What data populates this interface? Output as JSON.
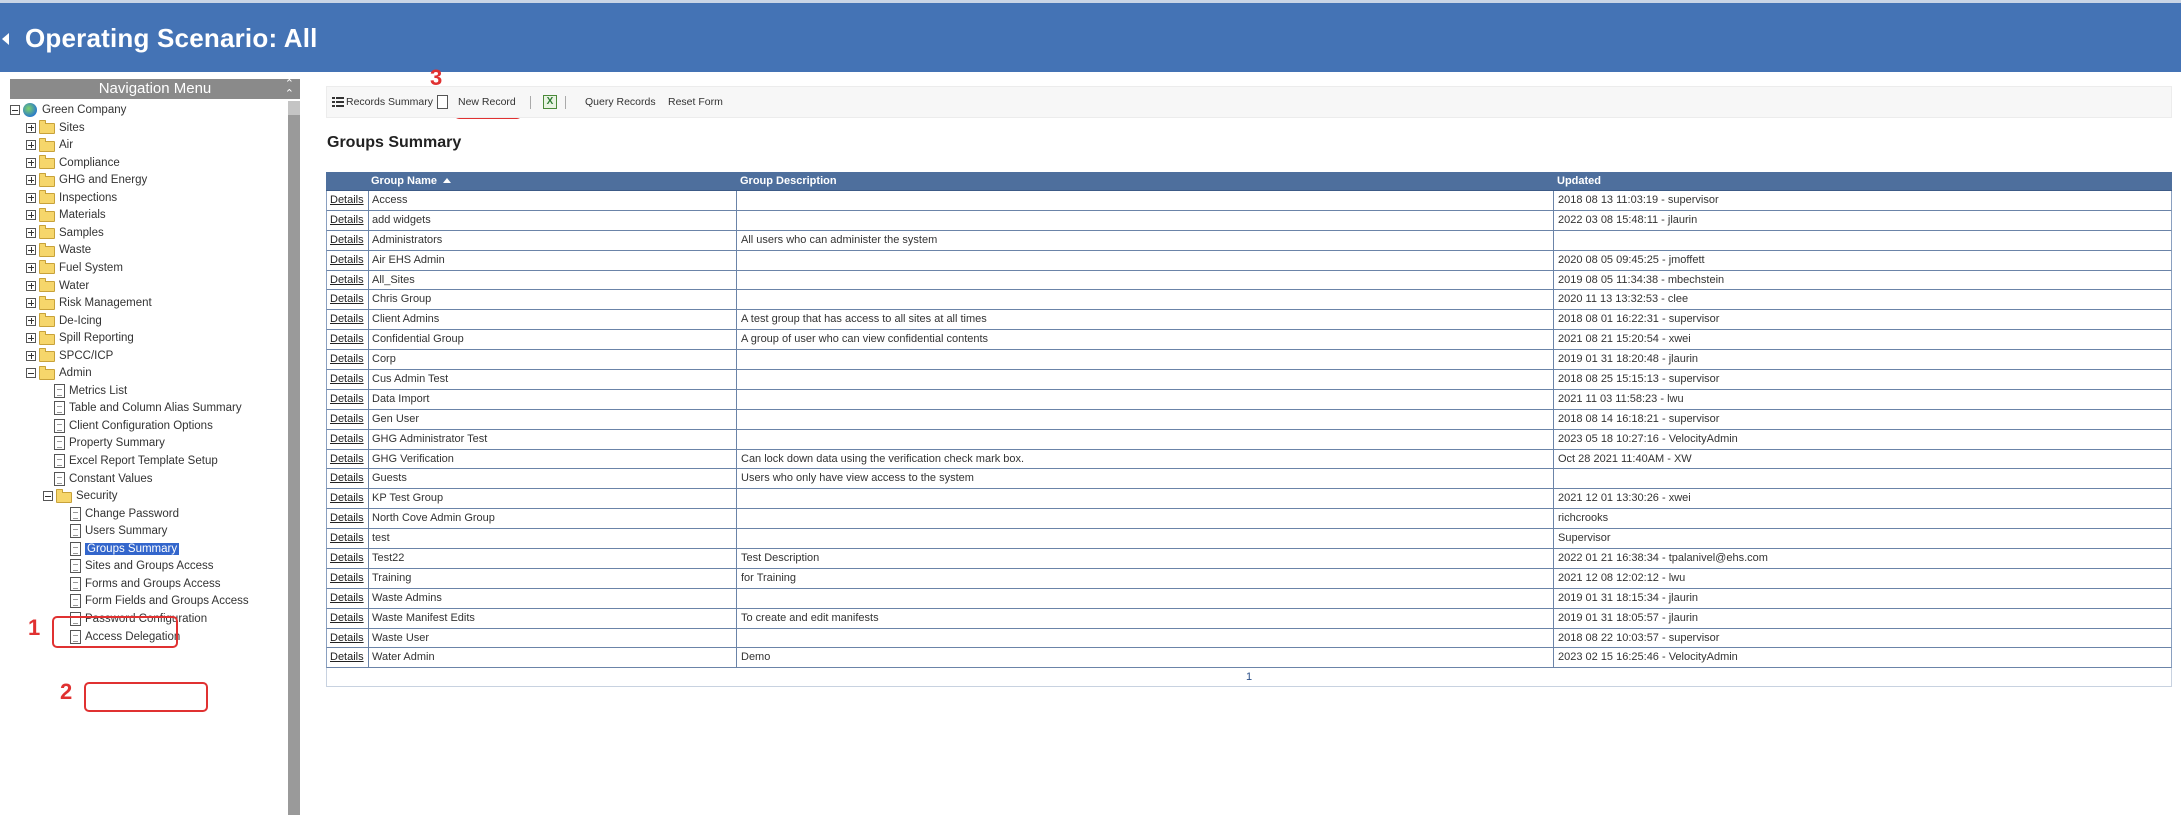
{
  "header": {
    "title": "Operating Scenario: All"
  },
  "nav": {
    "title": "Navigation Menu",
    "root": "Green Company",
    "folders": [
      "Sites",
      "Air",
      "Compliance",
      "GHG and Energy",
      "Inspections",
      "Materials",
      "Samples",
      "Waste",
      "Fuel System",
      "Water",
      "Risk Management",
      "De-Icing",
      "Spill Reporting",
      "SPCC/ICP"
    ],
    "admin": {
      "label": "Admin",
      "items": [
        "Metrics List",
        "Table and Column Alias Summary",
        "Client Configuration Options",
        "Property Summary",
        "Excel Report Template Setup",
        "Constant Values"
      ],
      "security": {
        "label": "Security",
        "items": [
          "Change Password",
          "Users Summary",
          "Groups Summary",
          "Sites and Groups Access",
          "Forms and Groups Access",
          "Form Fields and Groups Access",
          "Password Configuration",
          "Access Delegation"
        ]
      }
    }
  },
  "callouts": {
    "one": "1",
    "two": "2",
    "three": "3"
  },
  "toolbar": {
    "records_summary": "Records Summary",
    "new_record": "New Record",
    "excel": "X",
    "query_records": "Query Records",
    "reset_form": "Reset Form"
  },
  "page": {
    "title": "Groups Summary"
  },
  "table": {
    "columns": [
      "Group Name",
      "Group Description",
      "Updated"
    ],
    "details_label": "Details",
    "rows": [
      {
        "name": "Access",
        "desc": "",
        "updated": "2018 08 13 11:03:19 - supervisor"
      },
      {
        "name": "add widgets",
        "desc": "",
        "updated": "2022 03 08 15:48:11 - jlaurin"
      },
      {
        "name": "Administrators",
        "desc": "All users who can administer the system",
        "updated": ""
      },
      {
        "name": "Air EHS Admin",
        "desc": "",
        "updated": "2020 08 05 09:45:25 - jmoffett"
      },
      {
        "name": "All_Sites",
        "desc": "",
        "updated": "2019 08 05 11:34:38 - mbechstein"
      },
      {
        "name": "Chris Group",
        "desc": "",
        "updated": "2020 11 13 13:32:53 - clee"
      },
      {
        "name": "Client Admins",
        "desc": "A test group that has access to all sites at all times",
        "updated": "2018 08 01 16:22:31 - supervisor"
      },
      {
        "name": "Confidential Group",
        "desc": "A group of user who can view confidential contents",
        "updated": "2021 08 21 15:20:54 - xwei"
      },
      {
        "name": "Corp",
        "desc": "",
        "updated": "2019 01 31 18:20:48 - jlaurin"
      },
      {
        "name": "Cus Admin Test",
        "desc": "",
        "updated": "2018 08 25 15:15:13 - supervisor"
      },
      {
        "name": "Data Import",
        "desc": "",
        "updated": "2021 11 03 11:58:23 - lwu"
      },
      {
        "name": "Gen User",
        "desc": "",
        "updated": "2018 08 14 16:18:21 - supervisor"
      },
      {
        "name": "GHG Administrator Test",
        "desc": "",
        "updated": "2023 05 18 10:27:16 - VelocityAdmin"
      },
      {
        "name": "GHG Verification",
        "desc": "Can lock down data using the verification check mark box.",
        "updated": "Oct 28 2021 11:40AM - XW"
      },
      {
        "name": "Guests",
        "desc": "Users who only have view access to the system",
        "updated": ""
      },
      {
        "name": "KP Test Group",
        "desc": "",
        "updated": "2021 12 01 13:30:26 - xwei"
      },
      {
        "name": "North Cove Admin Group",
        "desc": "",
        "updated": "richcrooks"
      },
      {
        "name": "test",
        "desc": "",
        "updated": "Supervisor"
      },
      {
        "name": "Test22",
        "desc": "Test Description",
        "updated": "2022 01 21 16:38:34 - tpalanivel@ehs.com"
      },
      {
        "name": "Training",
        "desc": "for Training",
        "updated": "2021 12 08 12:02:12 - lwu"
      },
      {
        "name": "Waste Admins",
        "desc": "",
        "updated": "2019 01 31 18:15:34 - jlaurin"
      },
      {
        "name": "Waste Manifest Edits",
        "desc": "To create and edit manifests",
        "updated": "2019 01 31 18:05:57 - jlaurin"
      },
      {
        "name": "Waste User",
        "desc": "",
        "updated": "2018 08 22 10:03:57 - supervisor"
      },
      {
        "name": "Water Admin",
        "desc": "Demo",
        "updated": "2023 02 15 16:25:46 - VelocityAdmin"
      }
    ],
    "pager": "1"
  }
}
